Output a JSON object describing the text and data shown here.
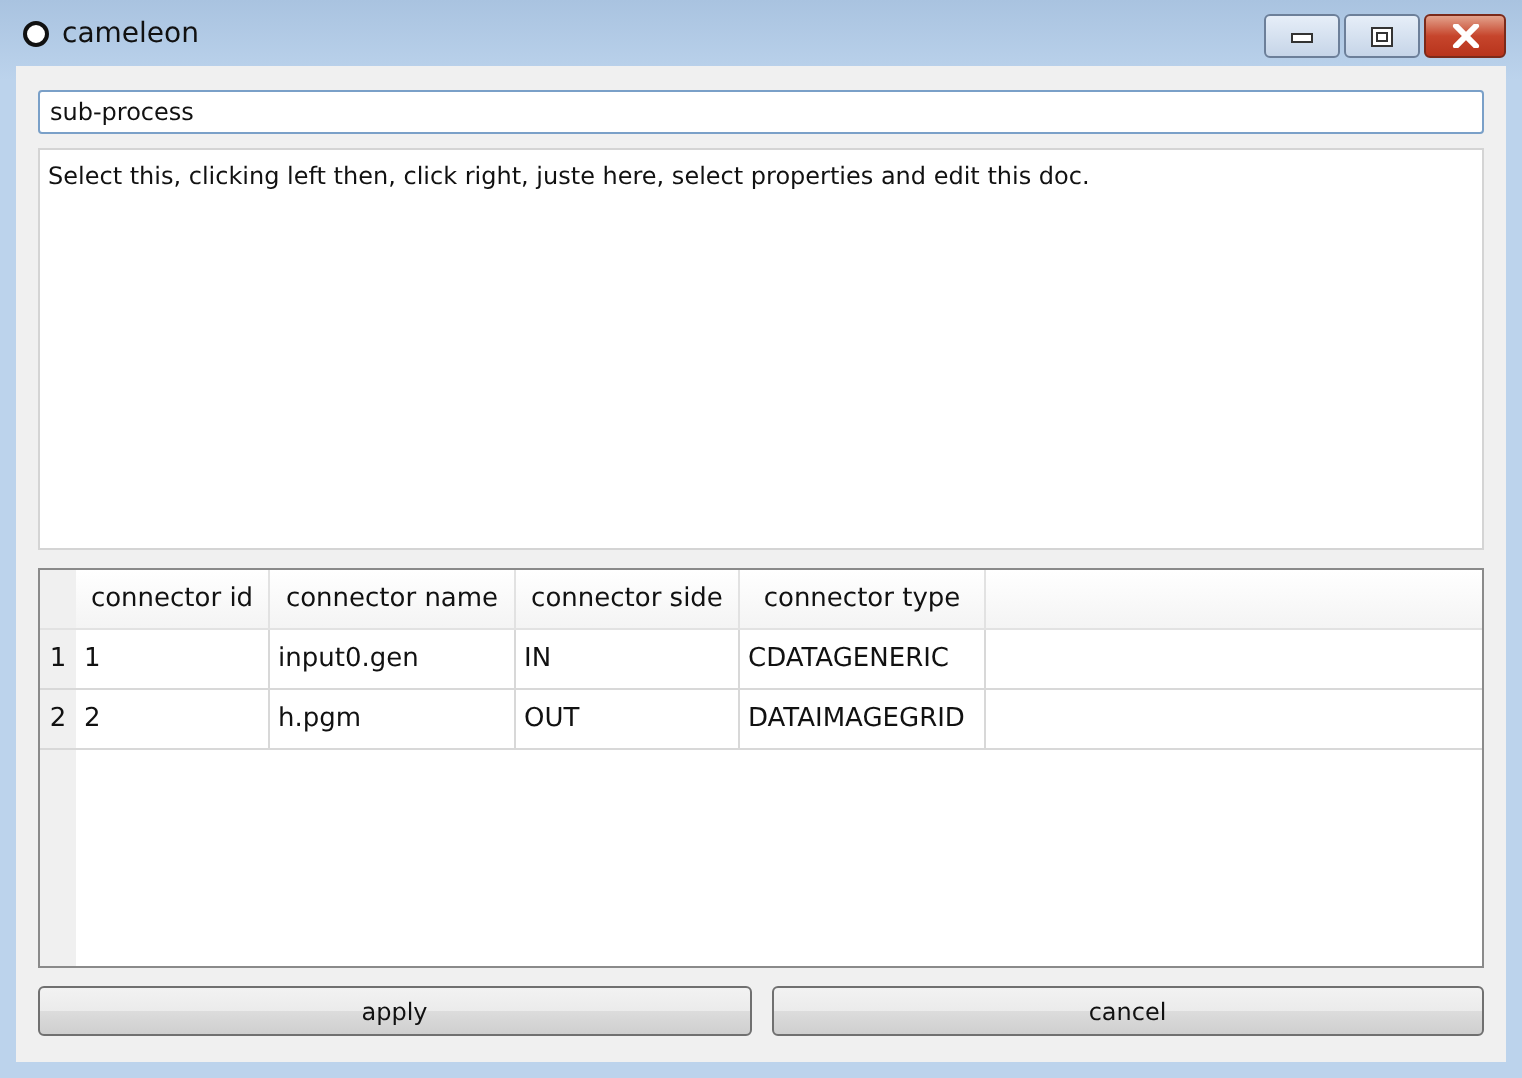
{
  "window": {
    "title": "cameleon"
  },
  "name_field": {
    "value": "sub-process"
  },
  "description": {
    "value": "Select this, clicking left then, click right, juste here, select properties and edit this doc."
  },
  "table": {
    "columns": [
      "connector id",
      "connector name",
      "connector side",
      "connector type"
    ],
    "rows": [
      {
        "header": "1",
        "cells": [
          "1",
          "input0.gen",
          "IN",
          "CDATAGENERIC"
        ]
      },
      {
        "header": "2",
        "cells": [
          "2",
          "h.pgm",
          "OUT",
          "DATAIMAGEGRID"
        ]
      }
    ]
  },
  "buttons": [
    "apply",
    "cancel"
  ]
}
